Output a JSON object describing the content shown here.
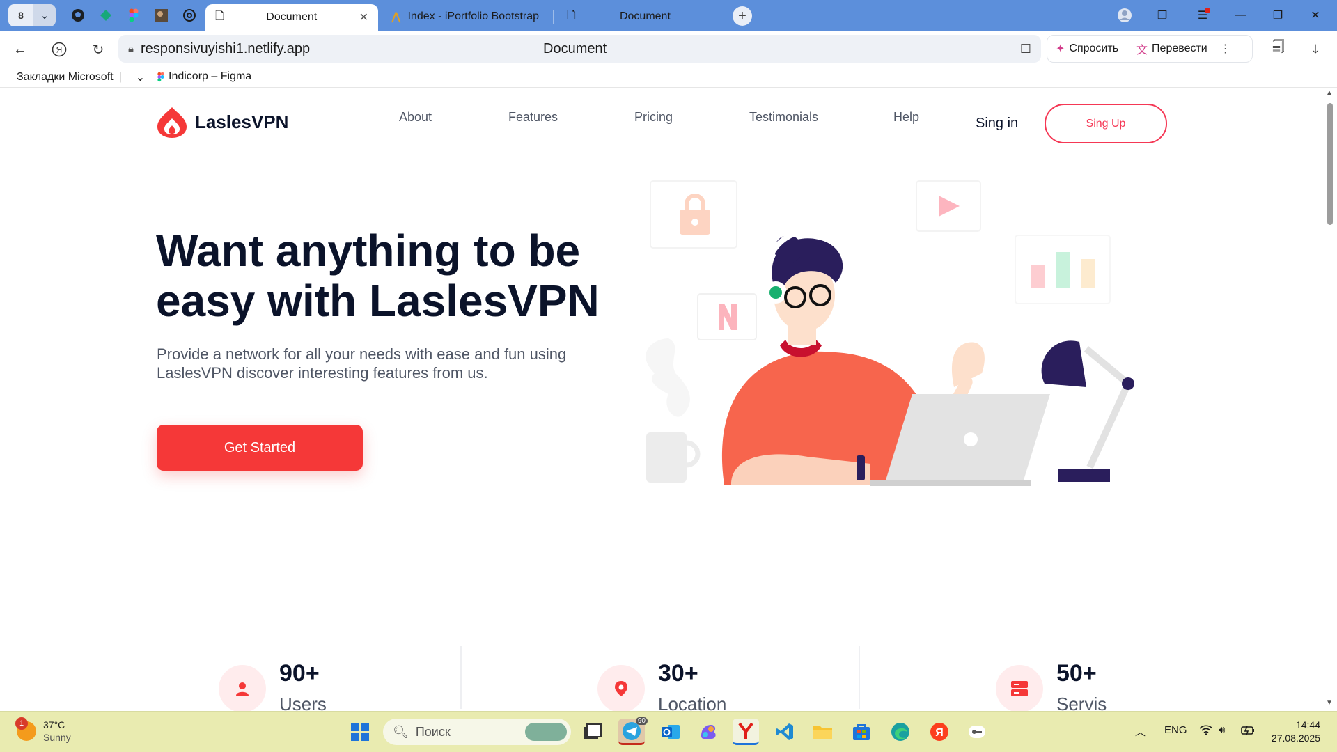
{
  "browser": {
    "tab_counter": "8",
    "tabs": [
      {
        "label": "Document"
      },
      {
        "label": "Index - iPortfolio Bootstrap"
      },
      {
        "label": "Document"
      }
    ],
    "url": "responsivuyishi1.netlify.app",
    "page_title": "Document",
    "ai_actions": {
      "ask": "Спросить",
      "translate": "Перевести"
    },
    "bookmarks": [
      {
        "label": "Закладки Microsoft"
      },
      {
        "label": "Indicorp – Figma"
      }
    ]
  },
  "site": {
    "logo_text": "LaslesVPN",
    "nav": {
      "about": "About",
      "features": "Features",
      "pricing": "Pricing",
      "testimonials": "Testimonials",
      "help": "Help"
    },
    "sign_in": "Sing in",
    "sign_up": "Sing Up",
    "hero": {
      "title_line1": "Want anything to be",
      "title_line2": "easy with LaslesVPN",
      "subtitle_line1": "Provide a network for all your needs with ease and fun using",
      "subtitle_line2": "LaslesVPN discover interesting features from us.",
      "cta": "Get Started"
    },
    "stats": [
      {
        "value": "90+",
        "label": "Users",
        "icon": "user-icon"
      },
      {
        "value": "30+",
        "label": "Location",
        "icon": "location-pin-icon"
      },
      {
        "value": "50+",
        "label": "Servis",
        "icon": "server-icon"
      }
    ],
    "colors": {
      "accent": "#F53838",
      "text_dark": "#0B132A",
      "text_muted": "#4F5665"
    }
  },
  "taskbar": {
    "weather": {
      "temp": "37°C",
      "condition": "Sunny",
      "badge": "1"
    },
    "search_placeholder": "Поиск",
    "telegram_badge": "90",
    "language": "ENG",
    "time": "14:44",
    "date": "27.08.2025"
  }
}
